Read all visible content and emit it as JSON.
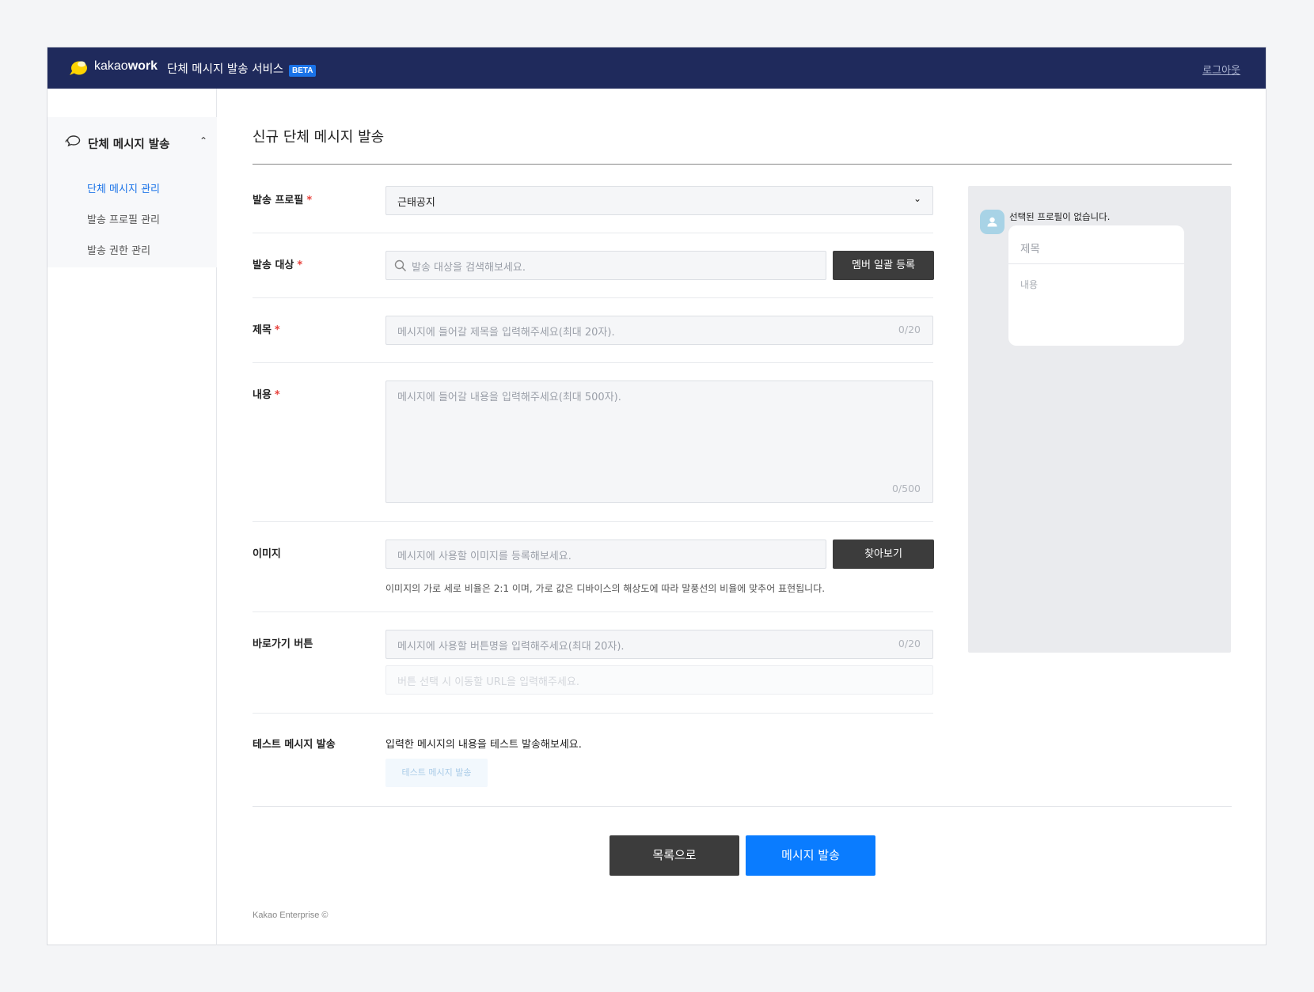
{
  "header": {
    "brand_light": "kakao",
    "brand_bold": "work",
    "service": "단체 메시지 발송 서비스",
    "badge": "BETA",
    "logout": "로그아웃"
  },
  "sidebar": {
    "section_title": "단체 메시지 발송",
    "items": [
      {
        "label": "단체 메시지 관리",
        "active": true
      },
      {
        "label": "발송 프로필 관리",
        "active": false
      },
      {
        "label": "발송 권한 관리",
        "active": false
      }
    ]
  },
  "page": {
    "title": "신규 단체 메시지 발송"
  },
  "form": {
    "required_mark": "*",
    "profile": {
      "label": "발송 프로필",
      "value": "근태공지"
    },
    "target": {
      "label": "발송 대상",
      "placeholder": "발송 대상을 검색해보세요.",
      "button": "멤버 일괄 등록"
    },
    "subject": {
      "label": "제목",
      "placeholder": "메시지에 들어갈 제목을 입력해주세요(최대 20자).",
      "counter": "0/20"
    },
    "body": {
      "label": "내용",
      "placeholder": "메시지에 들어갈 내용을 입력해주세요(최대 500자).",
      "counter": "0/500"
    },
    "image": {
      "label": "이미지",
      "placeholder": "메시지에 사용할 이미지를 등록해보세요.",
      "button": "찾아보기",
      "hint": "이미지의 가로 세로 비율은 2:1 이며, 가로 값은 디바이스의 해상도에 따라 말풍선의 비율에 맞추어 표현됩니다."
    },
    "link_button": {
      "label": "바로가기 버튼",
      "name_placeholder": "메시지에 사용할 버튼명을 입력해주세요(최대 20자).",
      "counter": "0/20",
      "url_placeholder": "버튼 선택 시 이동할 URL을 입력해주세요."
    },
    "test": {
      "label": "테스트 메시지 발송",
      "description": "입력한 메시지의 내용을 테스트 발송해보세요.",
      "button": "테스트 메시지 발송"
    }
  },
  "preview": {
    "profile_text": "선택된 프로필이 없습니다.",
    "title": "제목",
    "body": "내용"
  },
  "actions": {
    "list": "목록으로",
    "send": "메시지 발송"
  },
  "footer": "Kakao Enterprise ©",
  "colors": {
    "topbar": "#1f2a5c",
    "primary": "#0a7cff",
    "dark_button": "#3c3c3c",
    "required": "#e8413c",
    "active_link": "#1a73e8"
  }
}
